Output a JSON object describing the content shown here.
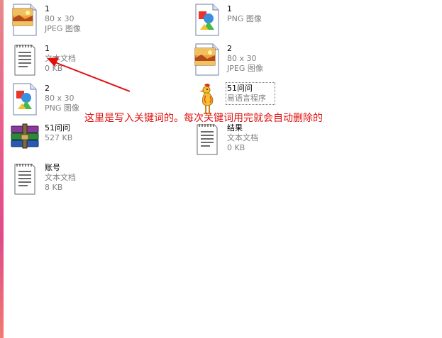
{
  "files": [
    {
      "name": "1",
      "line2": "80 x 30",
      "line3": "JPEG 图像",
      "icon": "jpeg-image-icon"
    },
    {
      "name": "1",
      "line2": "PNG 图像",
      "line3": "",
      "icon": "png-image-icon"
    },
    {
      "name": "1",
      "line2": "文本文档",
      "line3": "0 KB",
      "icon": "text-document-icon"
    },
    {
      "name": "2",
      "line2": "80 x 30",
      "line3": "JPEG 图像",
      "icon": "jpeg-image-icon"
    },
    {
      "name": "2",
      "line2": "80 x 30",
      "line3": "PNG 图像",
      "icon": "png-image-icon"
    },
    {
      "name": "51问问",
      "line2": "易语言程序",
      "line3": "",
      "icon": "e-language-program-icon"
    },
    {
      "name": "51问问",
      "line2": "527 KB",
      "line3": "",
      "icon": "rar-archive-icon"
    },
    {
      "name": "结果",
      "line2": "文本文档",
      "line3": "0 KB",
      "icon": "text-document-icon"
    },
    {
      "name": "账号",
      "line2": "文本文档",
      "line3": "8 KB",
      "icon": "text-document-icon"
    }
  ],
  "annotation": {
    "text": "这里是写入关键词的。每次关键词用完就会自动删除的",
    "color": "#e01010"
  },
  "colors": {
    "background": "#ffffff",
    "meta_text": "#808080",
    "name_text": "#000000",
    "left_edge": "#e04a8a"
  }
}
